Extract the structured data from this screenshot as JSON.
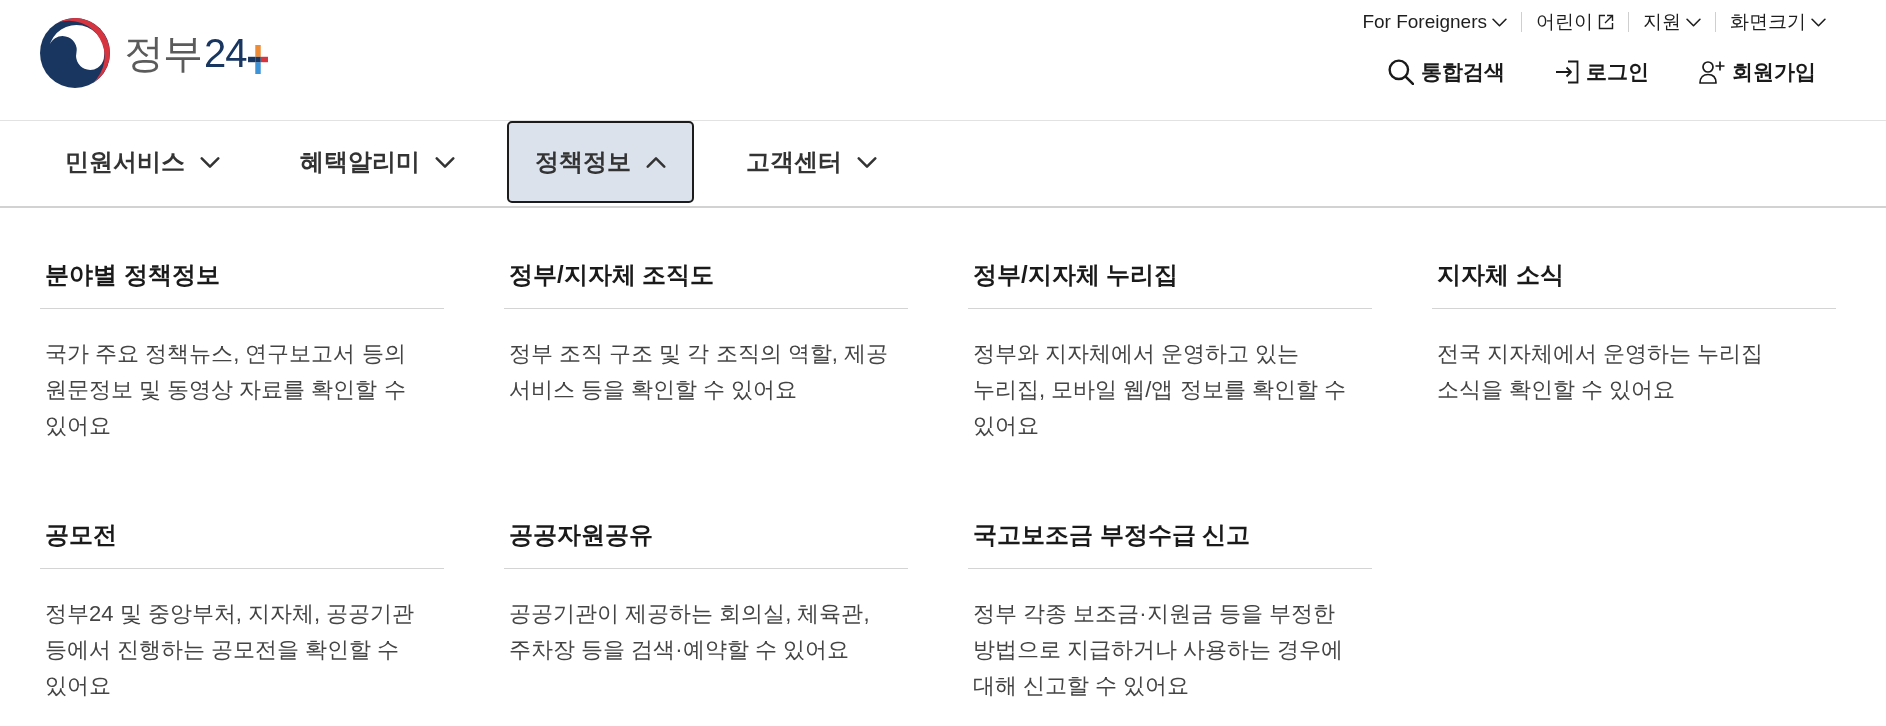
{
  "logo": {
    "wordmark": "정부",
    "number": "24"
  },
  "utility_links": [
    {
      "label": "For Foreigners",
      "kind": "dropdown"
    },
    {
      "label": "어린이",
      "kind": "external"
    },
    {
      "label": "지원",
      "kind": "dropdown"
    },
    {
      "label": "화면크기",
      "kind": "dropdown"
    }
  ],
  "actions": [
    {
      "label": "통합검색",
      "kind": "search"
    },
    {
      "label": "로그인",
      "kind": "login"
    },
    {
      "label": "회원가입",
      "kind": "signup"
    }
  ],
  "nav": [
    {
      "label": "민원서비스",
      "selected": false,
      "expanded": false
    },
    {
      "label": "혜택알리미",
      "selected": false,
      "expanded": false
    },
    {
      "label": "정책정보",
      "selected": true,
      "expanded": true
    },
    {
      "label": "고객센터",
      "selected": false,
      "expanded": false
    }
  ],
  "menu_sections": [
    {
      "title": "분야별 정책정보",
      "description": "국가 주요 정책뉴스, 연구보고서 등의 원문정보 및 동영상 자료를 확인할 수 있어요"
    },
    {
      "title": "정부/지자체 조직도",
      "description": "정부 조직 구조 및 각 조직의 역할, 제공 서비스 등을 확인할 수 있어요"
    },
    {
      "title": "정부/지자체 누리집",
      "description": "정부와 지자체에서 운영하고 있는 누리집, 모바일 웹/앱 정보를 확인할 수 있어요"
    },
    {
      "title": "지자체 소식",
      "description": "전국 지자체에서 운영하는 누리집 소식을 확인할 수 있어요"
    },
    {
      "title": "공모전",
      "description": "정부24 및 중앙부처, 지자체, 공공기관 등에서 진행하는 공모전을 확인할 수 있어요"
    },
    {
      "title": "공공자원공유",
      "description": "공공기관이 제공하는 회의실, 체육관, 주차장 등을 검색·예약할 수 있어요"
    },
    {
      "title": "국고보조금 부정수급 신고",
      "description": "정부 각종 보조금·지원금 등을 부정한 방법으로 지급하거나 사용하는 경우에 대해 신고할 수 있어요"
    }
  ]
}
